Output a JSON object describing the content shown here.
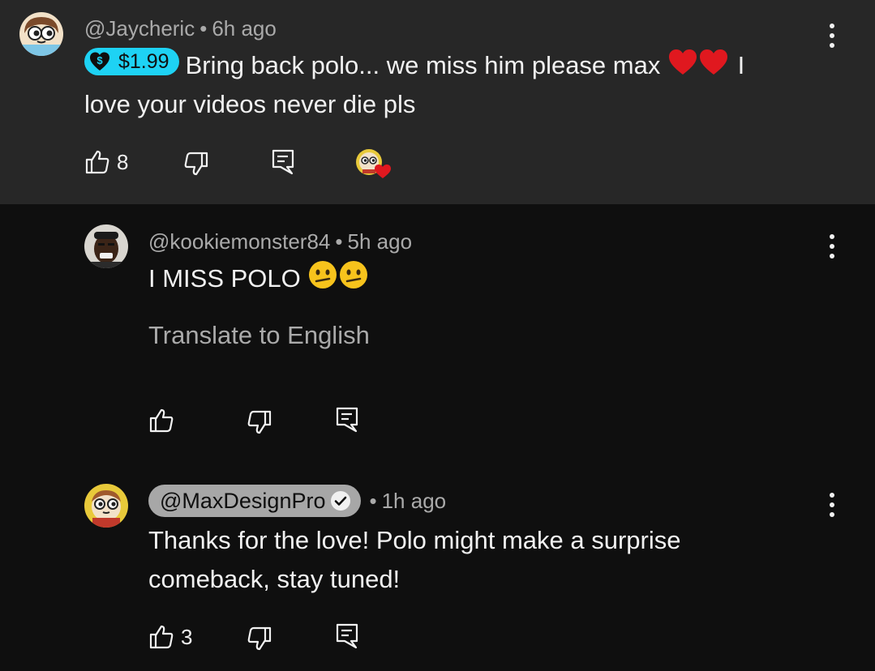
{
  "comments": [
    {
      "author": "@Jaycheric",
      "time": "6h ago",
      "super_thanks": "$1.99",
      "text_line1": "Bring back polo... we miss him please max",
      "text_after_hearts": "I",
      "text_line2": "love your videos never die pls",
      "likes": "8",
      "hearted_by_creator": true,
      "background": "#272727"
    },
    {
      "author": "@kookiemonster84",
      "time": "5h ago",
      "text": "I MISS POLO",
      "translate_label": "Translate to English",
      "likes": ""
    },
    {
      "author": "@MaxDesignPro",
      "time": "1h ago",
      "verified": true,
      "text_line1": "Thanks for the love! Polo might make a surprise",
      "text_line2": "comeback, stay tuned!",
      "likes": "3"
    }
  ],
  "meta_separator": "•",
  "colors": {
    "background": "#0f0f0f",
    "highlighted_comment_bg": "#272727",
    "super_thanks_badge": "#1ed2f4",
    "creator_pill": "#a7a7a7",
    "secondary_text": "#aaaaaa",
    "heart": "#e0181f"
  },
  "icons": [
    "like-icon",
    "dislike-icon",
    "reply-icon",
    "more-options-icon",
    "verified-check-icon",
    "dollar-heart-icon"
  ]
}
